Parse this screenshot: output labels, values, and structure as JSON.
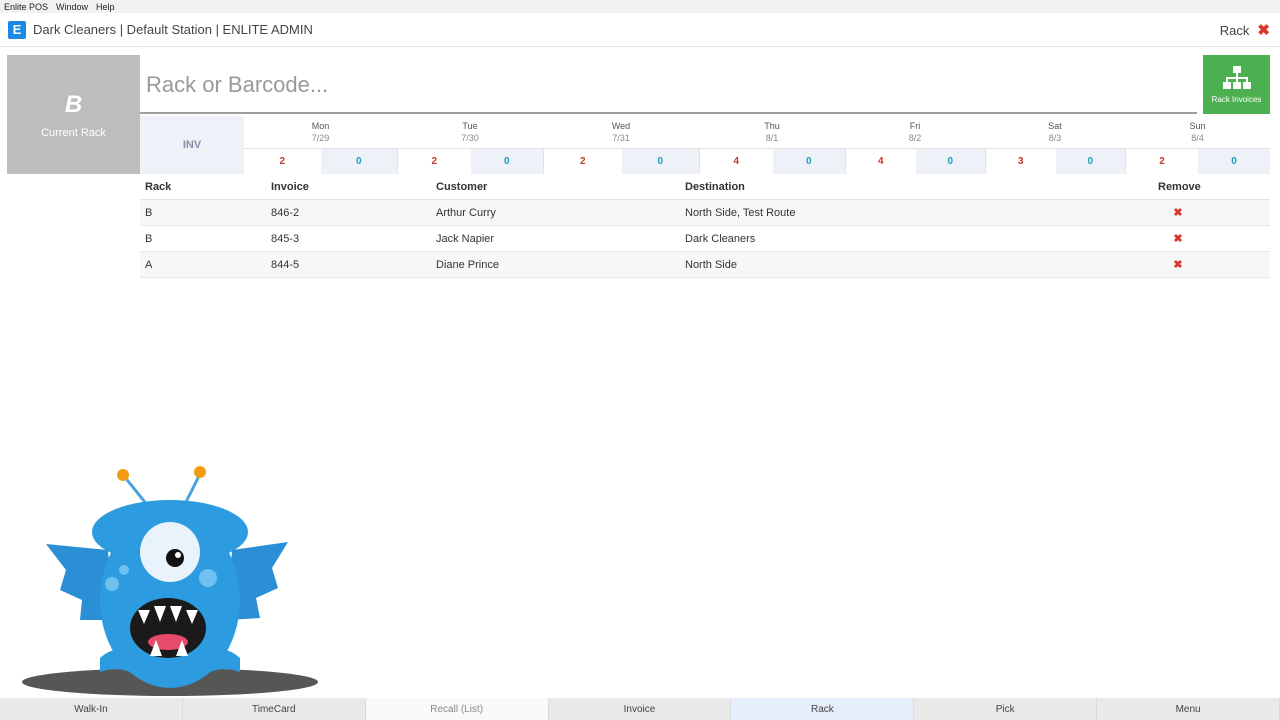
{
  "menubar": {
    "items": [
      "Enlite POS",
      "Window",
      "Help"
    ]
  },
  "titlebar": {
    "logo_letter": "E",
    "title": "Dark Cleaners | Default Station | ENLITE ADMIN",
    "right_label": "Rack",
    "close_glyph": "✖"
  },
  "current_rack": {
    "letter": "B",
    "label": "Current Rack"
  },
  "search": {
    "placeholder": "Rack or Barcode...",
    "value": ""
  },
  "rack_invoices_button": {
    "label": "Rack Invoices",
    "icon": "sitemap-icon",
    "color": "#4caf50"
  },
  "week": {
    "inv_label": "INV",
    "days": [
      {
        "name": "Mon",
        "date": "7/29",
        "red": "2",
        "teal": "0"
      },
      {
        "name": "Tue",
        "date": "7/30",
        "red": "2",
        "teal": "0"
      },
      {
        "name": "Wed",
        "date": "7/31",
        "red": "2",
        "teal": "0"
      },
      {
        "name": "Thu",
        "date": "8/1",
        "red": "4",
        "teal": "0"
      },
      {
        "name": "Fri",
        "date": "8/2",
        "red": "4",
        "teal": "0"
      },
      {
        "name": "Sat",
        "date": "8/3",
        "red": "3",
        "teal": "0"
      },
      {
        "name": "Sun",
        "date": "8/4",
        "red": "2",
        "teal": "0"
      }
    ]
  },
  "grid": {
    "headers": {
      "rack": "Rack",
      "invoice": "Invoice",
      "customer": "Customer",
      "destination": "Destination",
      "remove": "Remove"
    },
    "rows": [
      {
        "rack": "B",
        "invoice": "846-2",
        "customer": "Arthur Curry",
        "destination": "North Side, Test Route",
        "remove": "✖"
      },
      {
        "rack": "B",
        "invoice": "845-3",
        "customer": "Jack Napier",
        "destination": "Dark Cleaners",
        "remove": "✖"
      },
      {
        "rack": "A",
        "invoice": "844-5",
        "customer": "Diane Prince",
        "destination": "North Side",
        "remove": "✖"
      }
    ]
  },
  "bottom_tabs": [
    "Walk-In",
    "TimeCard",
    "Recall (List)",
    "Invoice",
    "Rack",
    "Pick",
    "Menu"
  ],
  "colors": {
    "accent_blue": "#1e88e5",
    "accent_green": "#4caf50",
    "count_red": "#c0392b",
    "count_teal": "#17a2b8",
    "remove_red": "#d9372b"
  }
}
